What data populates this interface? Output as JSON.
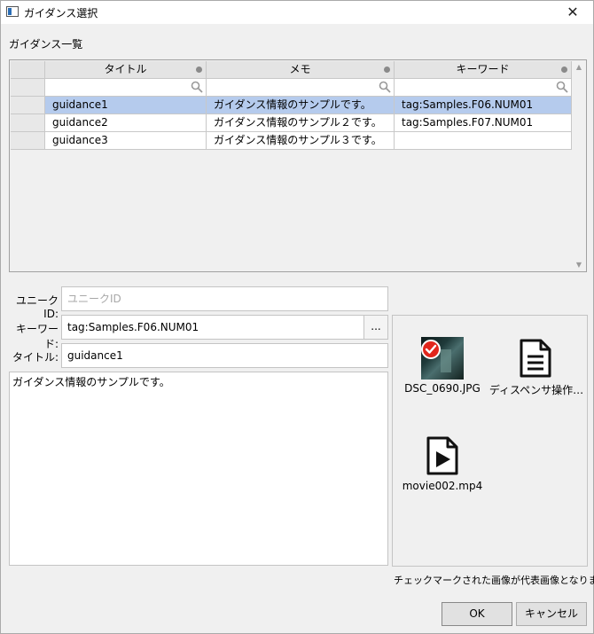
{
  "window": {
    "title": "ガイダンス選択",
    "close_glyph": "✕"
  },
  "list_section": {
    "label": "ガイダンス一覧",
    "columns": [
      "タイトル",
      "メモ",
      "キーワード"
    ],
    "rows": [
      {
        "title": "guidance1",
        "memo": "ガイダンス情報のサンプルです。",
        "keyword": "tag:Samples.F06.NUM01",
        "selected": true
      },
      {
        "title": "guidance2",
        "memo": "ガイダンス情報のサンプル２です。",
        "keyword": "tag:Samples.F07.NUM01",
        "selected": false
      },
      {
        "title": "guidance3",
        "memo": "ガイダンス情報のサンプル３です。",
        "keyword": "",
        "selected": false
      }
    ]
  },
  "form": {
    "unique_id_label": "ユニークID:",
    "unique_id_placeholder": "ユニークID",
    "keyword_label": "キーワード:",
    "keyword_value": "tag:Samples.F06.NUM01",
    "browse_label": "...",
    "title_label": "タイトル:",
    "title_value": "guidance1",
    "memo_value": "ガイダンス情報のサンプルです。"
  },
  "media": {
    "items": [
      {
        "name": "DSC_0690.JPG",
        "icon": "photo-thumbnail",
        "checked": true
      },
      {
        "name": "ディスペンサ操作…",
        "icon": "document-icon",
        "checked": false
      },
      {
        "name": "movie002.mp4",
        "icon": "video-file-icon",
        "checked": false
      }
    ],
    "note": "チェックマークされた画像が代表画像となります。"
  },
  "buttons": {
    "ok": "OK",
    "cancel": "キャンセル"
  },
  "colors": {
    "selected_row": "#b5cbed",
    "check_badge": "#e1261c",
    "background": "#f0f0f0"
  }
}
